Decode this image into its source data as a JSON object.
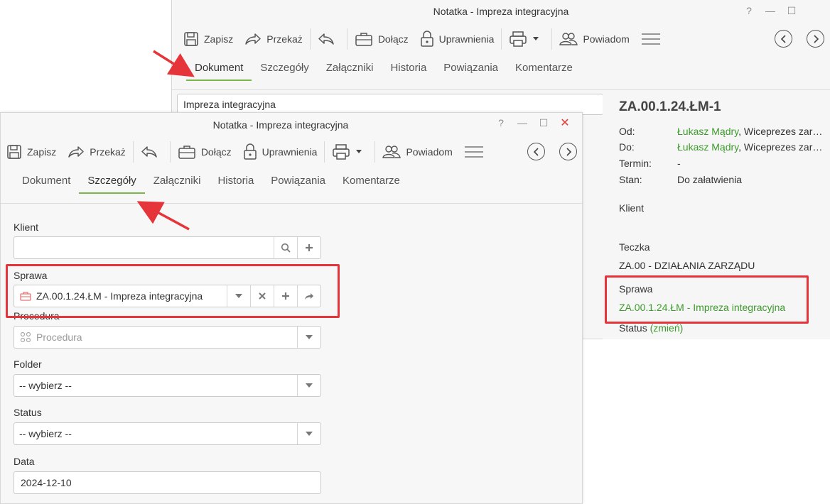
{
  "back_window": {
    "title": "Notatka - Impreza integracyjna",
    "controls": [
      "?",
      "—",
      "☐"
    ],
    "toolbar": {
      "save": "Zapisz",
      "forward": "Przekaż",
      "attach": "Dołącz",
      "permissions": "Uprawnienia",
      "notify": "Powiadom"
    },
    "tabs": [
      "Dokument",
      "Szczegóły",
      "Załączniki",
      "Historia",
      "Powiązania",
      "Komentarze"
    ],
    "active_tab": "Dokument",
    "subject_value": "Impreza integracyjna"
  },
  "side_panel": {
    "number": "ZA.00.1.24.ŁM-1",
    "from_label": "Od:",
    "from_name": "Łukasz Mądry",
    "from_role": ", Wiceprezes zar…",
    "to_label": "Do:",
    "to_name": "Łukasz Mądry",
    "to_role": ", Wiceprezes zar…",
    "deadline_label": "Termin:",
    "deadline_value": "-",
    "state_label": "Stan:",
    "state_value": "Do załatwienia",
    "client_label": "Klient",
    "folder_label": "Teczka",
    "folder_value": "ZA.00 - DZIAŁANIA ZARZĄDU",
    "case_label": "Sprawa",
    "case_value": "ZA.00.1.24.ŁM - Impreza integracyjna",
    "status_label": "Status",
    "status_change": "(zmień)"
  },
  "front_window": {
    "title": "Notatka - Impreza integracyjna",
    "controls": [
      "?",
      "—",
      "☐",
      "✕"
    ],
    "toolbar": {
      "save": "Zapisz",
      "forward": "Przekaż",
      "attach": "Dołącz",
      "permissions": "Uprawnienia",
      "notify": "Powiadom"
    },
    "tabs": [
      "Dokument",
      "Szczegóły",
      "Załączniki",
      "Historia",
      "Powiązania",
      "Komentarze"
    ],
    "active_tab": "Szczegóły",
    "form": {
      "client_label": "Klient",
      "client_value": "",
      "case_label": "Sprawa",
      "case_value": "ZA.00.1.24.ŁM - Impreza integracyjna",
      "procedure_label": "Procedura",
      "procedure_placeholder": "Procedura",
      "folder_label": "Folder",
      "folder_value": "-- wybierz --",
      "status_label": "Status",
      "status_value": "-- wybierz --",
      "date_label": "Data",
      "date_value": "2024-12-10"
    }
  },
  "colors": {
    "accent_green": "#7ab648",
    "link_green": "#3d9a2c",
    "highlight_red": "#e5343a"
  }
}
